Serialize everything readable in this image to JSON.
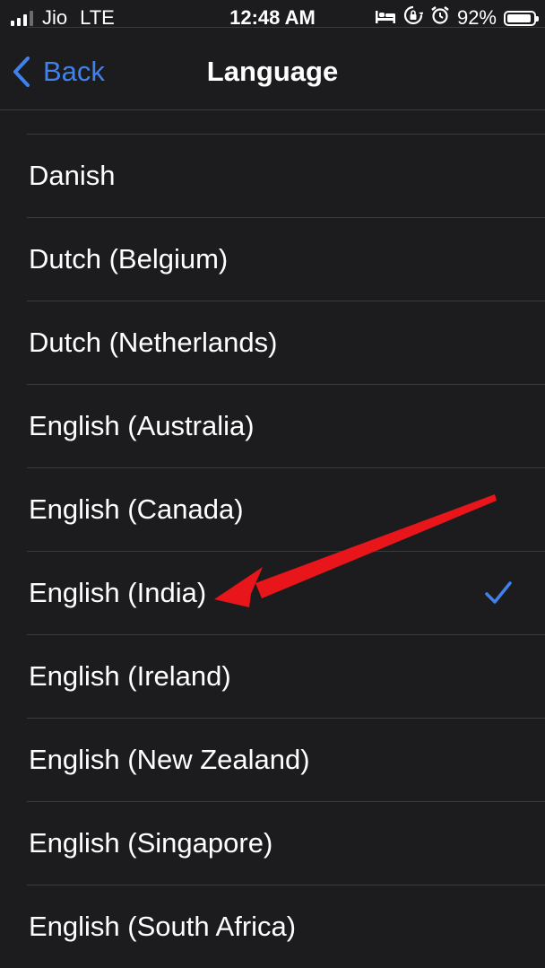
{
  "status_bar": {
    "carrier": "Jio",
    "network": "LTE",
    "time": "12:48 AM",
    "battery_percent": "92%",
    "battery_level": 0.92,
    "icons": [
      "signal-icon",
      "bed-icon",
      "rotation-lock-icon",
      "alarm-icon",
      "battery-icon"
    ]
  },
  "nav": {
    "back_label": "Back",
    "title": "Language"
  },
  "languages": [
    {
      "label": "Danish",
      "selected": false
    },
    {
      "label": "Dutch (Belgium)",
      "selected": false
    },
    {
      "label": "Dutch (Netherlands)",
      "selected": false
    },
    {
      "label": "English (Australia)",
      "selected": false
    },
    {
      "label": "English (Canada)",
      "selected": false
    },
    {
      "label": "English (India)",
      "selected": true
    },
    {
      "label": "English (Ireland)",
      "selected": false
    },
    {
      "label": "English (New Zealand)",
      "selected": false
    },
    {
      "label": "English (Singapore)",
      "selected": false
    },
    {
      "label": "English (South Africa)",
      "selected": false
    }
  ],
  "colors": {
    "accent": "#3f82ee",
    "annotation": "#e8151b",
    "background": "#1c1c1e",
    "separator": "#3a3a3c"
  },
  "annotation": {
    "type": "arrow",
    "target": "English (India)"
  }
}
